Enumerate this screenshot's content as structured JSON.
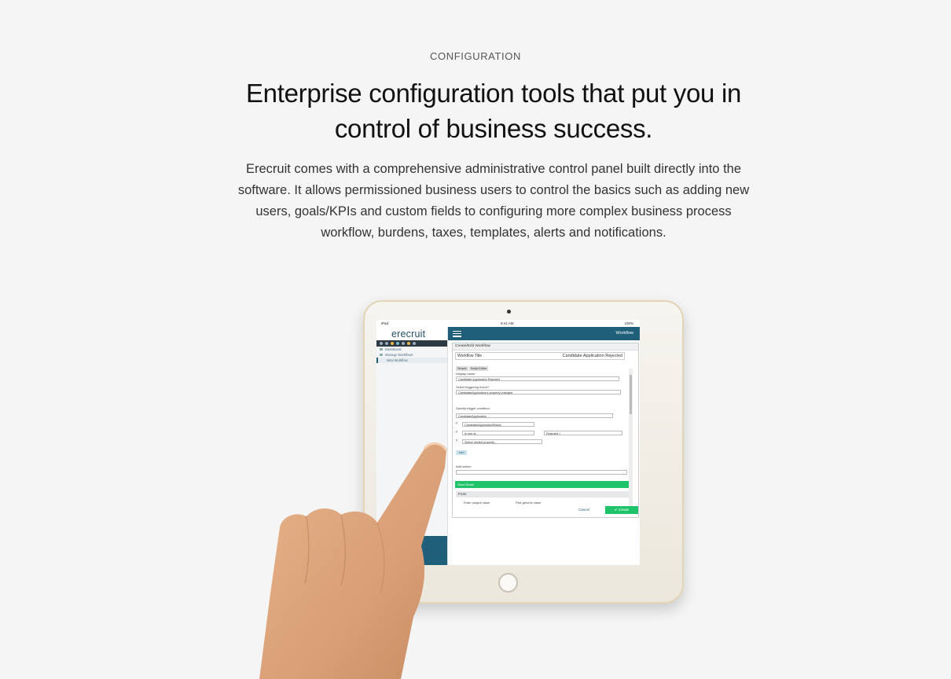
{
  "eyebrow": "CONFIGURATION",
  "headline_line1": "Enterprise configuration tools that put you in",
  "headline_line2": "control of business success.",
  "intro_line1": "Erecruit comes with a comprehensive administrative control panel built directly into the",
  "intro_line2": "software. It allows permissioned business users to control the basics such as adding new",
  "intro_line3": "users, goals/KPIs and custom fields to configuring more complex business process",
  "intro_line4": "workflow, burdens, taxes, templates, alerts and notifications.",
  "device": {
    "status": {
      "carrier": "iPad",
      "time": "9:41 AM",
      "battery": "100%"
    },
    "app": {
      "brand": "erecruit",
      "page_title": "Workflow",
      "nav": [
        "Dashboard",
        "Manage Workflows",
        "New Workflow"
      ],
      "form": {
        "header": "Create/Edit Workflow",
        "workflow_title_label": "Workflow Title",
        "workflow_title_value": "Candidate Application Rejected",
        "tabs": [
          "Simple",
          "Script Editor"
        ],
        "display_name_label": "Display name:",
        "display_name_value": "Candidate Application Rejected",
        "trigger_label": "Select triggering event:*",
        "trigger_value": "CandidateApplication's property changed",
        "condition_label": "Specify trigger condition:",
        "condition_value": "CandidateApplication",
        "condition_row1": "CandidateApplicationStatus",
        "condition_row2": "is one of...",
        "condition_tag": "Rejected ×",
        "condition_row3": "Select nested property...",
        "add_label": "Add",
        "action_label": "Add action:",
        "action_bar": "Send Email",
        "from_label": "From",
        "enter_unique": "Enter unique value",
        "pick_generic": "Pick generic value",
        "cancel": "Cancel",
        "create": "Create"
      }
    }
  },
  "colors": {
    "brand": "#1f5f7a",
    "green": "#1fc46a",
    "background": "#f5f5f5"
  }
}
